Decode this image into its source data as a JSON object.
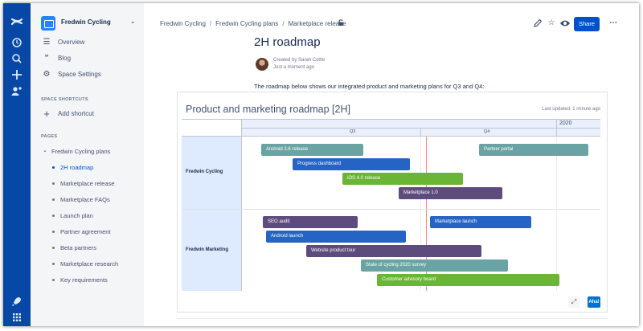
{
  "global_nav": {
    "icons": [
      "confluence-logo-icon",
      "recent-icon",
      "search-icon",
      "create-icon",
      "people-icon",
      "rocket-icon",
      "app-switcher-icon"
    ]
  },
  "sidebar": {
    "space_name": "Fredwin Cycling",
    "items": [
      {
        "label": "Overview",
        "icon": "overview-icon"
      },
      {
        "label": "Blog",
        "icon": "quote-icon"
      },
      {
        "label": "Space Settings",
        "icon": "gear-icon"
      }
    ],
    "shortcuts_heading": "SPACE SHORTCUTS",
    "add_shortcut": "Add shortcut",
    "pages_heading": "PAGES",
    "tree_root": "Fredwin Cycling plans",
    "pages": [
      "2H roadmap",
      "Marketplace release",
      "Marketplace FAQs",
      "Launch plan",
      "Partner agreement",
      "Beta partners",
      "Marketplace research",
      "Key requirements"
    ],
    "active_page_index": 0
  },
  "header": {
    "breadcrumbs": [
      "Fredwin Cycling",
      "Fredwin Cycling plans",
      "Marketplace release"
    ],
    "share_label": "Share",
    "icons": [
      "edit-icon",
      "star-icon",
      "watch-icon",
      "more-icon",
      "lock-icon"
    ]
  },
  "page": {
    "title": "2H roadmap",
    "author_line": "Created by Sarah Cottle",
    "time_line": "Just a moment ago",
    "intro": "The roadmap below shows our integrated product and marketing plans for Q3 and Q4:"
  },
  "roadmap": {
    "title": "Product and marketing roadmap [2H]",
    "last_updated": "Last updated: 1 minute ago",
    "year_label": "2020",
    "quarters": [
      "Q3",
      "Q4"
    ],
    "lanes": [
      {
        "name": "Fredwin Cycling",
        "bars": [
          {
            "label": "Android 3.6 release",
            "color": "#6aa3a3"
          },
          {
            "label": "Progress dashboard",
            "color": "#2563c4"
          },
          {
            "label": "iOS 4.0 release",
            "color": "#6ab536"
          },
          {
            "label": "Marketplace 1.0",
            "color": "#5e4b7e"
          },
          {
            "label": "Partner portal",
            "color": "#6aa3a3"
          }
        ]
      },
      {
        "name": "Fredwin Marketing",
        "bars": [
          {
            "label": "SEO audit",
            "color": "#5e4b7e"
          },
          {
            "label": "Marketplace launch",
            "color": "#2563c4"
          },
          {
            "label": "Android launch",
            "color": "#2563c4"
          },
          {
            "label": "Website product tour",
            "color": "#5e4b7e"
          },
          {
            "label": "State of cycling 2020 survey",
            "color": "#6aa3a3"
          },
          {
            "label": "Customer advisory board",
            "color": "#6ab536"
          }
        ]
      }
    ],
    "aha_label": "Aha!"
  }
}
